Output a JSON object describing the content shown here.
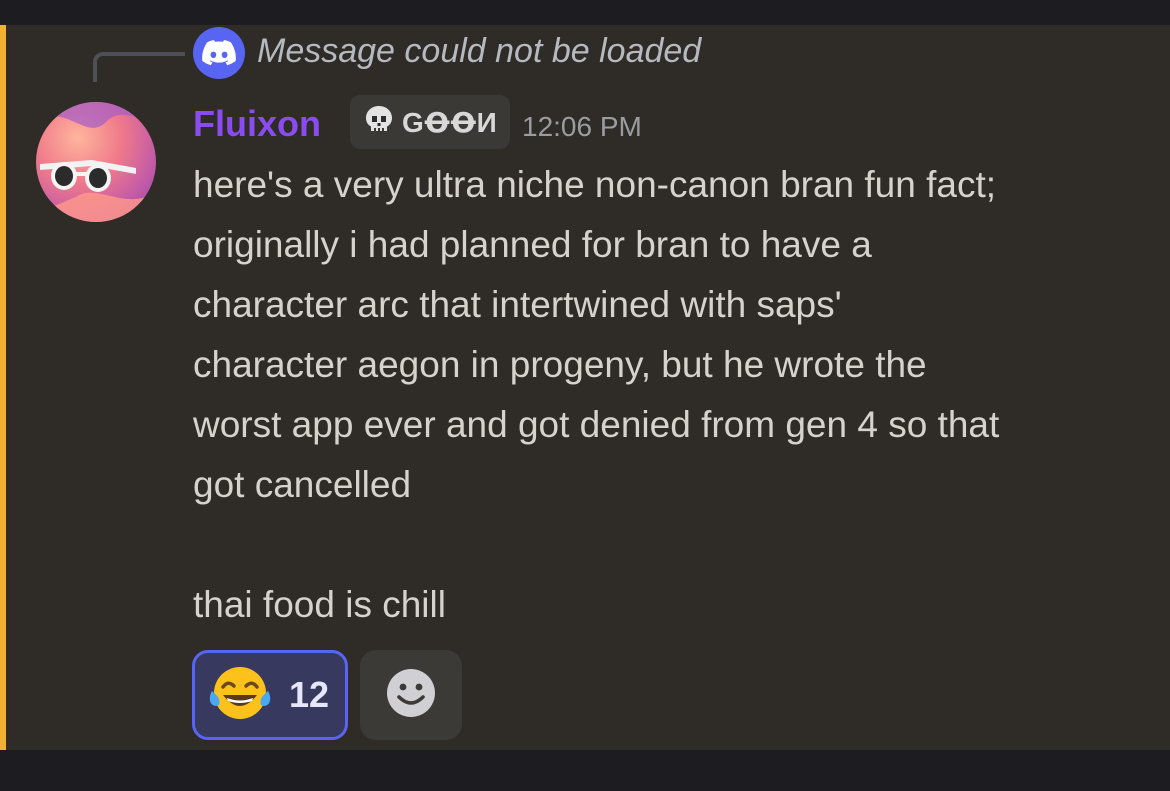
{
  "reply": {
    "icon": "discord-logo-icon",
    "text": "Message could not be loaded"
  },
  "author": {
    "avatar": "sunglasses-avatar",
    "username": "Fluixon",
    "tag_icon": "skull-icon",
    "tag": "GꝊꝊИ",
    "timestamp": "12:06 PM",
    "username_color": "#8a4cf0"
  },
  "message": {
    "lines": [
      "here's a very ultra niche non-canon bran fun fact;",
      "originally i had planned for bran to have a",
      "character arc that intertwined with saps'",
      "character aegon in progeny, but he wrote the",
      "worst app ever and got denied from gen 4 so that",
      "got cancelled"
    ],
    "footer": "thai food is chill"
  },
  "reactions": [
    {
      "emoji": "joy-emoji-icon",
      "count": "12",
      "active": true
    }
  ],
  "add_reaction": {
    "icon": "smiley-icon"
  },
  "colors": {
    "highlight": "#f0b232",
    "discord_blurple": "#5865f2",
    "message_bg": "#2f2b27"
  }
}
